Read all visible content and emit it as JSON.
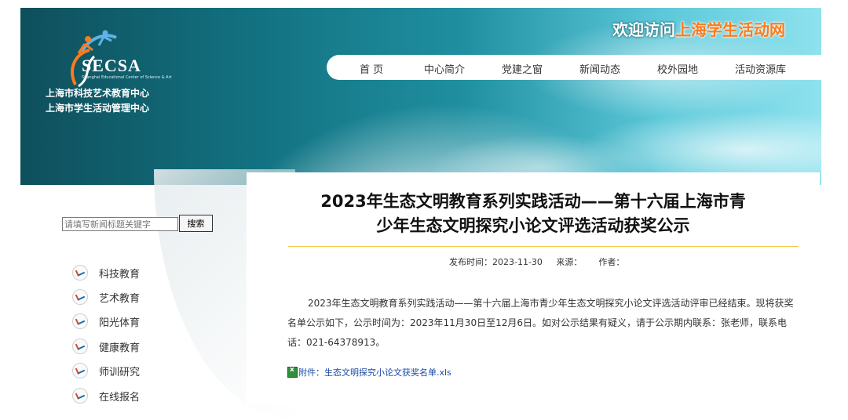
{
  "header": {
    "logo_text": "SECSA",
    "logo_subtext": "Shanghai Educational Center of Science & Art",
    "org_line1": "上海市科技艺术教育中心",
    "org_line2": "上海市学生活动管理中心",
    "welcome_prefix": "欢迎访问",
    "welcome_highlight": "上海学生活动网"
  },
  "nav": {
    "items": [
      {
        "label": "首 页"
      },
      {
        "label": "中心简介"
      },
      {
        "label": "党建之窗"
      },
      {
        "label": "新闻动态"
      },
      {
        "label": "校外园地"
      },
      {
        "label": "活动资源库"
      }
    ]
  },
  "search": {
    "placeholder": "请填写新闻标题关键字",
    "button_label": "搜索"
  },
  "sidebar": {
    "items": [
      {
        "label": "科技教育",
        "icon": "secsa-bullet-icon"
      },
      {
        "label": "艺术教育",
        "icon": "secsa-bullet-icon"
      },
      {
        "label": "阳光体育",
        "icon": "secsa-bullet-icon"
      },
      {
        "label": "健康教育",
        "icon": "secsa-bullet-icon"
      },
      {
        "label": "师训研究",
        "icon": "secsa-bullet-icon"
      },
      {
        "label": "在线报名",
        "icon": "secsa-bullet-icon"
      }
    ]
  },
  "article": {
    "title_line1": "2023年生态文明教育系列实践活动——第十六届上海市青",
    "title_line2": "少年生态文明探究小论文评选活动获奖公示",
    "meta": "发布时间：2023-11-30     来源：      作者：",
    "body": "2023年生态文明教育系列实践活动——第十六届上海市青少年生态文明探究小论文评选活动评审已经结束。现将获奖名单公示如下，公示时间为：2023年11月30日至12月6日。如对公示结果有疑义，请于公示期内联系：张老师，联系电话：021-64378913。",
    "attachment": "附件：生态文明探究小论文获奖名单.xls"
  },
  "colors": {
    "header_dark": "#0f4f5c",
    "header_light": "#8fe2ee",
    "welcome_highlight": "#ff7a1a",
    "divider": "#f2c84a",
    "link": "#1a4aa6"
  }
}
